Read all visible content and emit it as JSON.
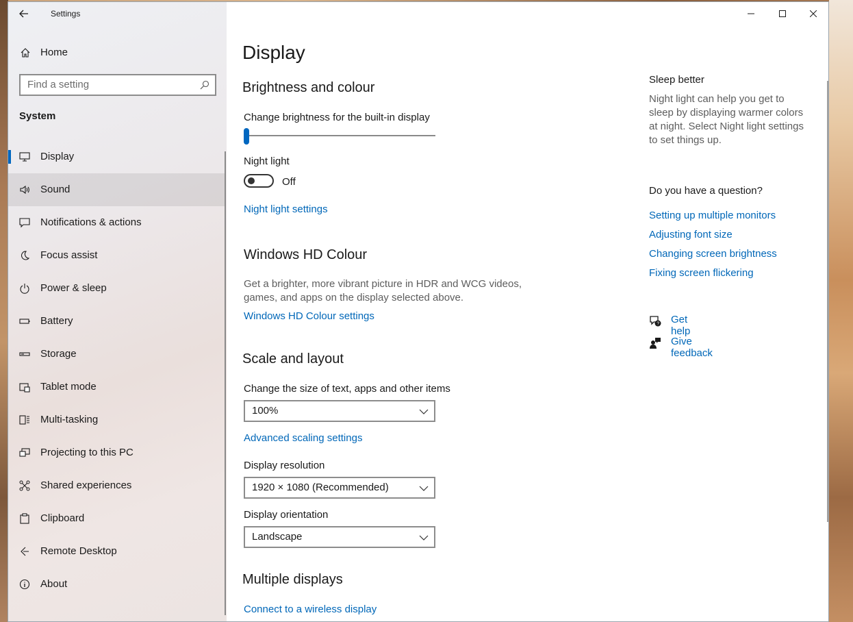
{
  "app": {
    "title": "Settings"
  },
  "sidebar": {
    "home_label": "Home",
    "search_placeholder": "Find a setting",
    "section": "System",
    "items": [
      {
        "label": "Display",
        "icon": "monitor-icon"
      },
      {
        "label": "Sound",
        "icon": "speaker-icon"
      },
      {
        "label": "Notifications & actions",
        "icon": "notification-icon"
      },
      {
        "label": "Focus assist",
        "icon": "moon-icon"
      },
      {
        "label": "Power & sleep",
        "icon": "power-icon"
      },
      {
        "label": "Battery",
        "icon": "battery-icon"
      },
      {
        "label": "Storage",
        "icon": "storage-icon"
      },
      {
        "label": "Tablet mode",
        "icon": "tablet-icon"
      },
      {
        "label": "Multi-tasking",
        "icon": "multitask-icon"
      },
      {
        "label": "Projecting to this PC",
        "icon": "projector-icon"
      },
      {
        "label": "Shared experiences",
        "icon": "shared-icon"
      },
      {
        "label": "Clipboard",
        "icon": "clipboard-icon"
      },
      {
        "label": "Remote Desktop",
        "icon": "remote-icon"
      },
      {
        "label": "About",
        "icon": "info-icon"
      }
    ]
  },
  "main": {
    "title": "Display",
    "brightness": {
      "heading": "Brightness and colour",
      "slider_label": "Change brightness for the built-in display",
      "slider_value_percent": 0,
      "night_light_label": "Night light",
      "toggle_state": "Off",
      "night_light_link": "Night light settings"
    },
    "hd": {
      "heading": "Windows HD Colour",
      "desc_line1": "Get a brighter, more vibrant picture in HDR and WCG videos,",
      "desc_line2": "games, and apps on the display selected above.",
      "link": "Windows HD Colour settings"
    },
    "scale": {
      "heading": "Scale and layout",
      "size_label": "Change the size of text, apps and other items",
      "size_value": "100%",
      "advanced_link": "Advanced scaling settings",
      "resolution_label": "Display resolution",
      "resolution_value": "1920 × 1080 (Recommended)",
      "orientation_label": "Display orientation",
      "orientation_value": "Landscape"
    },
    "multi": {
      "heading": "Multiple displays",
      "link": "Connect to a wireless display"
    }
  },
  "aside": {
    "sleep_heading": "Sleep better",
    "sleep_line1": "Night light can help you get to",
    "sleep_line2": "sleep by displaying warmer colors",
    "sleep_line3": "at night. Select Night light settings",
    "sleep_line4": "to set things up.",
    "question_heading": "Do you have a question?",
    "links": [
      "Setting up multiple monitors",
      "Adjusting font size",
      "Changing screen brightness",
      "Fixing screen flickering"
    ],
    "get_help": "Get help",
    "give_feedback": "Give feedback"
  },
  "colors": {
    "accent": "#0067c0",
    "link": "#0067b8"
  }
}
